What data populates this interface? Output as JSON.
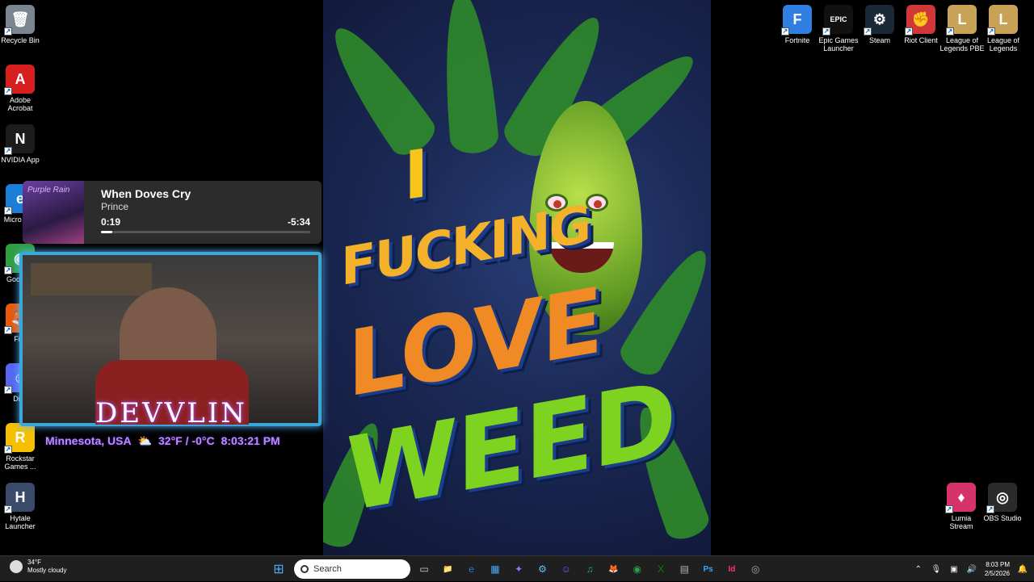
{
  "desktop_icons_left": [
    {
      "label": "Recycle Bin",
      "glyph": "🗑",
      "color": "#7a8590"
    },
    {
      "label": "Adobe Acrobat",
      "glyph": "A",
      "color": "#d71f1f"
    },
    {
      "label": "NVIDIA App",
      "glyph": "N",
      "color": "#1c1c1c"
    },
    {
      "label": "Micro Edg",
      "glyph": "e",
      "color": "#1c7ed6"
    },
    {
      "label": "Goo Chr",
      "glyph": "◉",
      "color": "#2f9e44"
    },
    {
      "label": "Fire",
      "glyph": "🦊",
      "color": "#e8590c"
    },
    {
      "label": "Disc",
      "glyph": "☺",
      "color": "#5865f2"
    },
    {
      "label": "Rockstar Games ...",
      "glyph": "R",
      "color": "#f6c000"
    },
    {
      "label": "Hytale Launcher",
      "glyph": "H",
      "color": "#3a4a6a"
    }
  ],
  "desktop_icons_top_right": [
    {
      "label": "Fortnite",
      "glyph": "F",
      "color": "#2f7fe0"
    },
    {
      "label": "Epic Games Launcher",
      "glyph": "EPIC",
      "color": "#111111"
    },
    {
      "label": "Steam",
      "glyph": "⚙",
      "color": "#1b2838"
    },
    {
      "label": "Riot Client",
      "glyph": "✊",
      "color": "#d13639"
    },
    {
      "label": "League of Legends PBE",
      "glyph": "L",
      "color": "#c8a256"
    },
    {
      "label": "League of Legends",
      "glyph": "L",
      "color": "#c8a256"
    }
  ],
  "desktop_icons_bottom_right": [
    {
      "label": "Lumia Stream",
      "glyph": "♦",
      "color": "#d6336c"
    },
    {
      "label": "OBS Studio",
      "glyph": "◎",
      "color": "#2b2b2b"
    }
  ],
  "wallpaper": {
    "line1": "I",
    "line2": "FUCKING",
    "line3": "LOVE",
    "line4": "WEED"
  },
  "media": {
    "album_text": "Purple Rain",
    "title": "When Doves Cry",
    "artist": "Prince",
    "elapsed": "0:19",
    "remaining": "-5:34",
    "progress": 0.055
  },
  "webcam": {
    "streamer_name": "DEVVLIN",
    "location": "Minnesota, USA",
    "weather_icon": "⛅",
    "temperature": "32°F / -0°C",
    "time": "8:03:21 PM"
  },
  "taskbar": {
    "weather_temp": "34°F",
    "weather_desc": "Mostly cloudy",
    "weather_badge": "4",
    "search_placeholder": "Search",
    "apps": [
      {
        "name": "task-view",
        "glyph": "▭",
        "color": "#cfd4da"
      },
      {
        "name": "file-explorer",
        "glyph": "📁",
        "color": "#f2c14e"
      },
      {
        "name": "edge",
        "glyph": "e",
        "color": "#1c7ed6"
      },
      {
        "name": "store",
        "glyph": "▦",
        "color": "#4dabf7"
      },
      {
        "name": "copilot",
        "glyph": "✦",
        "color": "#9775fa"
      },
      {
        "name": "steam",
        "glyph": "⚙",
        "color": "#66c0f4"
      },
      {
        "name": "discord",
        "glyph": "☺",
        "color": "#5865f2"
      },
      {
        "name": "spotify",
        "glyph": "♫",
        "color": "#1db954"
      },
      {
        "name": "firefox",
        "glyph": "🦊",
        "color": "#e8590c"
      },
      {
        "name": "chrome",
        "glyph": "◉",
        "color": "#2f9e44"
      },
      {
        "name": "xbox",
        "glyph": "X",
        "color": "#107c10"
      },
      {
        "name": "notepad",
        "glyph": "▤",
        "color": "#adb5bd"
      },
      {
        "name": "photoshop",
        "glyph": "Ps",
        "color": "#31a8ff"
      },
      {
        "name": "indesign",
        "glyph": "Id",
        "color": "#ff3366"
      },
      {
        "name": "obs",
        "glyph": "◎",
        "color": "#aaaaaa"
      }
    ],
    "clock_time": "8:03 PM",
    "clock_date": "2/5/2026"
  }
}
